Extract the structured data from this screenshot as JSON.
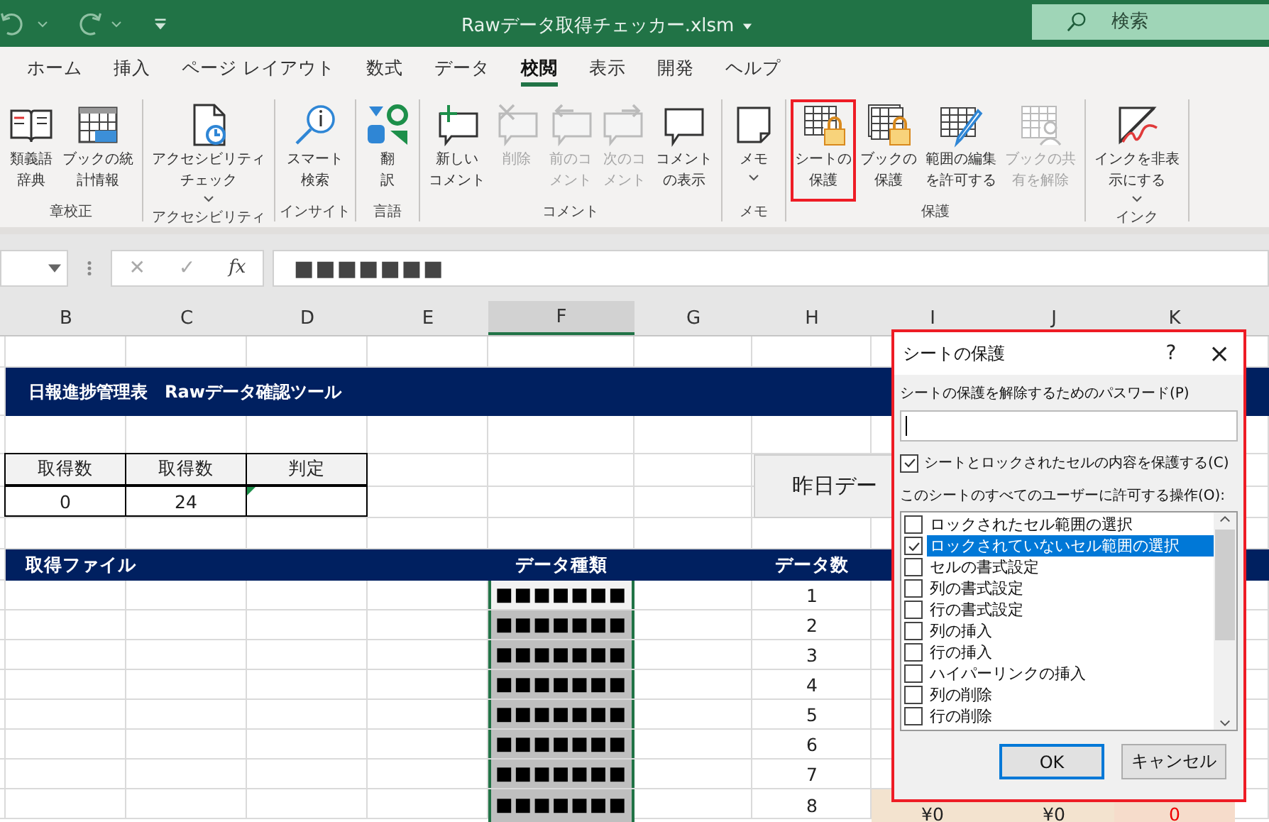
{
  "title_bar": {
    "title": "Rawデータ取得チェッカー.xlsm",
    "search_placeholder": "検索"
  },
  "tabs": [
    {
      "label": "ホーム",
      "selected": false
    },
    {
      "label": "挿入",
      "selected": false
    },
    {
      "label": "ページ レイアウト",
      "selected": false
    },
    {
      "label": "数式",
      "selected": false
    },
    {
      "label": "データ",
      "selected": false
    },
    {
      "label": "校閲",
      "selected": true
    },
    {
      "label": "表示",
      "selected": false
    },
    {
      "label": "開発",
      "selected": false
    },
    {
      "label": "ヘルプ",
      "selected": false
    }
  ],
  "ribbon": {
    "groups": [
      {
        "label": "章校正",
        "buttons": [
          {
            "lines": [
              "類義語",
              "辞典"
            ],
            "disabled": false,
            "highlighted": false,
            "dropdown": false
          },
          {
            "lines": [
              "ブックの統",
              "計情報"
            ],
            "disabled": false,
            "highlighted": false,
            "dropdown": false
          }
        ]
      },
      {
        "label": "アクセシビリティ",
        "buttons": [
          {
            "lines": [
              "アクセシビリティ",
              "チェック"
            ],
            "disabled": false,
            "highlighted": false,
            "dropdown": true
          }
        ]
      },
      {
        "label": "インサイト",
        "buttons": [
          {
            "lines": [
              "スマート",
              "検索"
            ],
            "disabled": false,
            "highlighted": false,
            "dropdown": false
          }
        ]
      },
      {
        "label": "言語",
        "buttons": [
          {
            "lines": [
              "翻",
              "訳"
            ],
            "disabled": false,
            "highlighted": false,
            "dropdown": false
          }
        ]
      },
      {
        "label": "コメント",
        "buttons": [
          {
            "lines": [
              "新しい",
              "コメント"
            ],
            "disabled": false,
            "highlighted": false,
            "dropdown": false
          },
          {
            "lines": [
              "削除"
            ],
            "disabled": true,
            "highlighted": false,
            "dropdown": false
          },
          {
            "lines": [
              "前のコ",
              "メント"
            ],
            "disabled": true,
            "highlighted": false,
            "dropdown": false
          },
          {
            "lines": [
              "次のコ",
              "メント"
            ],
            "disabled": true,
            "highlighted": false,
            "dropdown": false
          },
          {
            "lines": [
              "コメント",
              "の表示"
            ],
            "disabled": false,
            "highlighted": false,
            "dropdown": false
          }
        ]
      },
      {
        "label": "メモ",
        "buttons": [
          {
            "lines": [
              "メモ"
            ],
            "disabled": false,
            "highlighted": false,
            "dropdown": true
          }
        ]
      },
      {
        "label": "保護",
        "buttons": [
          {
            "lines": [
              "シートの",
              "保護"
            ],
            "disabled": false,
            "highlighted": true,
            "dropdown": false
          },
          {
            "lines": [
              "ブックの",
              "保護"
            ],
            "disabled": false,
            "highlighted": false,
            "dropdown": false
          },
          {
            "lines": [
              "範囲の編集",
              "を許可する"
            ],
            "disabled": false,
            "highlighted": false,
            "dropdown": false
          },
          {
            "lines": [
              "ブックの共",
              "有を解除"
            ],
            "disabled": true,
            "highlighted": false,
            "dropdown": false
          }
        ]
      },
      {
        "label": "インク",
        "buttons": [
          {
            "lines": [
              "インクを非表",
              "示にする"
            ],
            "disabled": false,
            "highlighted": false,
            "dropdown": true
          }
        ]
      }
    ]
  },
  "formula_bar": {
    "cancel": "✕",
    "enter": "✓",
    "function": "fx",
    "value": "■■■■■■■"
  },
  "sheet": {
    "columns": [
      {
        "label": "B",
        "selected": false
      },
      {
        "label": "C",
        "selected": false
      },
      {
        "label": "D",
        "selected": false
      },
      {
        "label": "E",
        "selected": false
      },
      {
        "label": "F",
        "selected": true
      },
      {
        "label": "G",
        "selected": false
      },
      {
        "label": "H",
        "selected": false
      },
      {
        "label": "I",
        "selected": false
      },
      {
        "label": "J",
        "selected": false
      },
      {
        "label": "K",
        "selected": false
      }
    ],
    "title": "日報進捗管理表　Rawデータ確認ツール",
    "summary_headers": [
      "取得数",
      "取得数",
      "判定"
    ],
    "summary_values": [
      "0",
      "24"
    ],
    "button": "昨日デー",
    "list_headers": {
      "file": "取得ファイル",
      "type": "データ種類",
      "count": "データ数"
    },
    "rows": [
      {
        "type": "■■■■■■■",
        "count": "1",
        "selected": true
      },
      {
        "type": "■■■■■■■",
        "count": "2",
        "selected": false
      },
      {
        "type": "■■■■■■■",
        "count": "3",
        "selected": false
      },
      {
        "type": "■■■■■■■",
        "count": "4",
        "selected": false
      },
      {
        "type": "■■■■■■■",
        "count": "5",
        "selected": false
      },
      {
        "type": "■■■■■■■",
        "count": "6",
        "selected": false
      },
      {
        "type": "■■■■■■■",
        "count": "7",
        "selected": false
      },
      {
        "type": "■■■■■■■",
        "count": "8",
        "selected": false,
        "column_i": "¥0",
        "column_j": "¥0",
        "column_k": "0"
      }
    ]
  },
  "dialog": {
    "title": "シートの保護",
    "help": "?",
    "close": "×",
    "highlighted": true,
    "password_label": "シートの保護を解除するためのパスワード(P)",
    "protect": {
      "label": "シートとロックされたセルの内容を保護する(C)",
      "checked": true
    },
    "list_label": "このシートのすべてのユーザーに許可する操作(O):",
    "options": [
      {
        "label": "ロックされたセル範囲の選択",
        "checked": false,
        "selected": false
      },
      {
        "label": "ロックされていないセル範囲の選択",
        "checked": true,
        "selected": true
      },
      {
        "label": "セルの書式設定",
        "checked": false,
        "selected": false
      },
      {
        "label": "列の書式設定",
        "checked": false,
        "selected": false
      },
      {
        "label": "行の書式設定",
        "checked": false,
        "selected": false
      },
      {
        "label": "列の挿入",
        "checked": false,
        "selected": false
      },
      {
        "label": "行の挿入",
        "checked": false,
        "selected": false
      },
      {
        "label": "ハイパーリンクの挿入",
        "checked": false,
        "selected": false
      },
      {
        "label": "列の削除",
        "checked": false,
        "selected": false
      },
      {
        "label": "行の削除",
        "checked": false,
        "selected": false
      }
    ],
    "buttons": [
      {
        "label": "OK",
        "default": true
      },
      {
        "label": "キャンセル",
        "default": false
      }
    ]
  }
}
